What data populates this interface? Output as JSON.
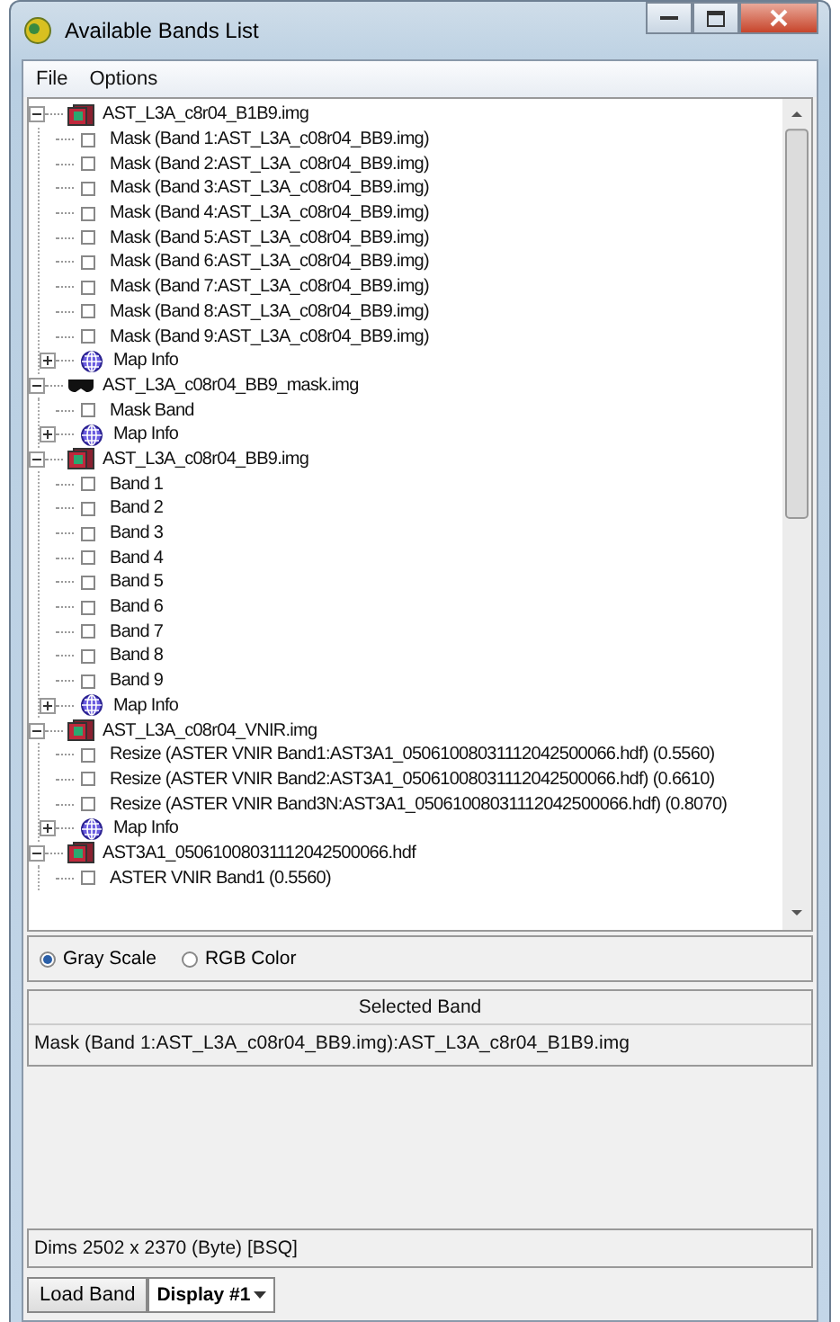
{
  "window": {
    "title": "Available Bands List"
  },
  "menu": [
    "File",
    "Options"
  ],
  "tree": [
    {
      "kind": "file",
      "label": "AST_L3A_c8r04_B1B9.img",
      "expanded": true,
      "children": [
        {
          "kind": "band",
          "label": "Mask (Band 1:AST_L3A_c08r04_BB9.img)"
        },
        {
          "kind": "band",
          "label": "Mask (Band 2:AST_L3A_c08r04_BB9.img)"
        },
        {
          "kind": "band",
          "label": "Mask (Band 3:AST_L3A_c08r04_BB9.img)"
        },
        {
          "kind": "band",
          "label": "Mask (Band 4:AST_L3A_c08r04_BB9.img)"
        },
        {
          "kind": "band",
          "label": "Mask (Band 5:AST_L3A_c08r04_BB9.img)"
        },
        {
          "kind": "band",
          "label": "Mask (Band 6:AST_L3A_c08r04_BB9.img)"
        },
        {
          "kind": "band",
          "label": "Mask (Band 7:AST_L3A_c08r04_BB9.img)"
        },
        {
          "kind": "band",
          "label": "Mask (Band 8:AST_L3A_c08r04_BB9.img)"
        },
        {
          "kind": "band",
          "label": "Mask (Band 9:AST_L3A_c08r04_BB9.img)"
        },
        {
          "kind": "mapinfo",
          "label": "Map Info",
          "expanded": false
        }
      ]
    },
    {
      "kind": "mask",
      "label": "AST_L3A_c08r04_BB9_mask.img",
      "expanded": true,
      "children": [
        {
          "kind": "band",
          "label": "Mask Band"
        },
        {
          "kind": "mapinfo",
          "label": "Map Info",
          "expanded": false
        }
      ]
    },
    {
      "kind": "file",
      "label": "AST_L3A_c08r04_BB9.img",
      "expanded": true,
      "children": [
        {
          "kind": "band",
          "label": "Band 1"
        },
        {
          "kind": "band",
          "label": "Band 2"
        },
        {
          "kind": "band",
          "label": "Band 3"
        },
        {
          "kind": "band",
          "label": "Band 4"
        },
        {
          "kind": "band",
          "label": "Band 5"
        },
        {
          "kind": "band",
          "label": "Band 6"
        },
        {
          "kind": "band",
          "label": "Band 7"
        },
        {
          "kind": "band",
          "label": "Band 8"
        },
        {
          "kind": "band",
          "label": "Band 9"
        },
        {
          "kind": "mapinfo",
          "label": "Map Info",
          "expanded": false
        }
      ]
    },
    {
      "kind": "file",
      "label": "AST_L3A_c08r04_VNIR.img",
      "expanded": true,
      "children": [
        {
          "kind": "band",
          "label": "Resize (ASTER VNIR Band1:AST3A1_05061008031112042500066.hdf) (0.5560)"
        },
        {
          "kind": "band",
          "label": "Resize (ASTER VNIR Band2:AST3A1_05061008031112042500066.hdf) (0.6610)"
        },
        {
          "kind": "band",
          "label": "Resize (ASTER VNIR Band3N:AST3A1_05061008031112042500066.hdf) (0.8070)"
        },
        {
          "kind": "mapinfo",
          "label": "Map Info",
          "expanded": false
        }
      ]
    },
    {
      "kind": "file",
      "label": "AST3A1_05061008031112042500066.hdf",
      "expanded": true,
      "children": [
        {
          "kind": "band",
          "label": "ASTER VNIR Band1 (0.5560)"
        }
      ]
    }
  ],
  "color_mode": [
    {
      "label": "Gray Scale",
      "selected": true
    },
    {
      "label": "RGB Color",
      "selected": false
    }
  ],
  "selected_band": {
    "header": "Selected Band",
    "value": "Mask (Band 1:AST_L3A_c08r04_BB9.img):AST_L3A_c8r04_B1B9.img"
  },
  "dims": "Dims 2502 x 2370 (Byte) [BSQ]",
  "buttons": {
    "load": "Load Band",
    "display": "Display #1"
  }
}
